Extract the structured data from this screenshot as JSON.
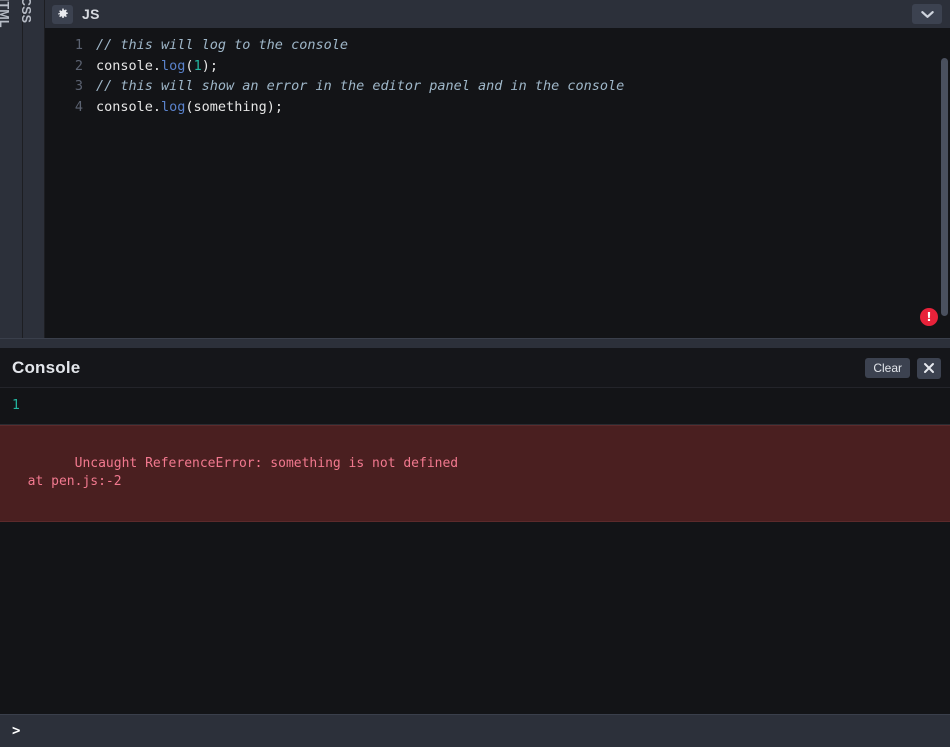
{
  "sidebar": {
    "panes": [
      {
        "label": "HTML",
        "name": "pane-html"
      },
      {
        "label": "CSS",
        "name": "pane-css"
      }
    ]
  },
  "editor": {
    "toolbar": {
      "settings_icon": "gear-icon",
      "language_label": "JS",
      "collapse_icon": "chevron-down-icon"
    },
    "lines": [
      {
        "number": "1",
        "tokens": [
          {
            "t": "// this will log to the console",
            "c": "tok-comment"
          }
        ]
      },
      {
        "number": "2",
        "tokens": [
          {
            "t": "console.",
            "c": "tok-prop"
          },
          {
            "t": "log",
            "c": "tok-fn"
          },
          {
            "t": "(",
            "c": "tok-plain"
          },
          {
            "t": "1",
            "c": "tok-num"
          },
          {
            "t": ");",
            "c": "tok-plain"
          }
        ]
      },
      {
        "number": "3",
        "tokens": [
          {
            "t": "// this will show an error in the editor panel and in the console",
            "c": "tok-comment"
          }
        ]
      },
      {
        "number": "4",
        "tokens": [
          {
            "t": "console.",
            "c": "tok-prop"
          },
          {
            "t": "log",
            "c": "tok-fn"
          },
          {
            "t": "(something);",
            "c": "tok-plain"
          }
        ]
      }
    ],
    "error_badge": {
      "glyph": "!",
      "color": "#e8223a"
    }
  },
  "console": {
    "title": "Console",
    "clear_label": "Clear",
    "close_icon": "close-icon",
    "rows": [
      {
        "type": "log",
        "text": "1"
      },
      {
        "type": "error",
        "text": "Uncaught ReferenceError: something is not defined\n  at pen.js:-2"
      }
    ],
    "prompt": {
      "chevron": ">",
      "value": "",
      "placeholder": ""
    }
  },
  "colors": {
    "background": "#1d1e22",
    "editor_background": "#131417",
    "chrome": "#2c303a",
    "button": "#3c4250",
    "error_red": "#e8223a",
    "error_bg": "#4a1f20",
    "error_text": "#f2798f",
    "log_teal": "#23b5a0",
    "comment": "#9fb7c9",
    "function_blue": "#5a82cb"
  }
}
